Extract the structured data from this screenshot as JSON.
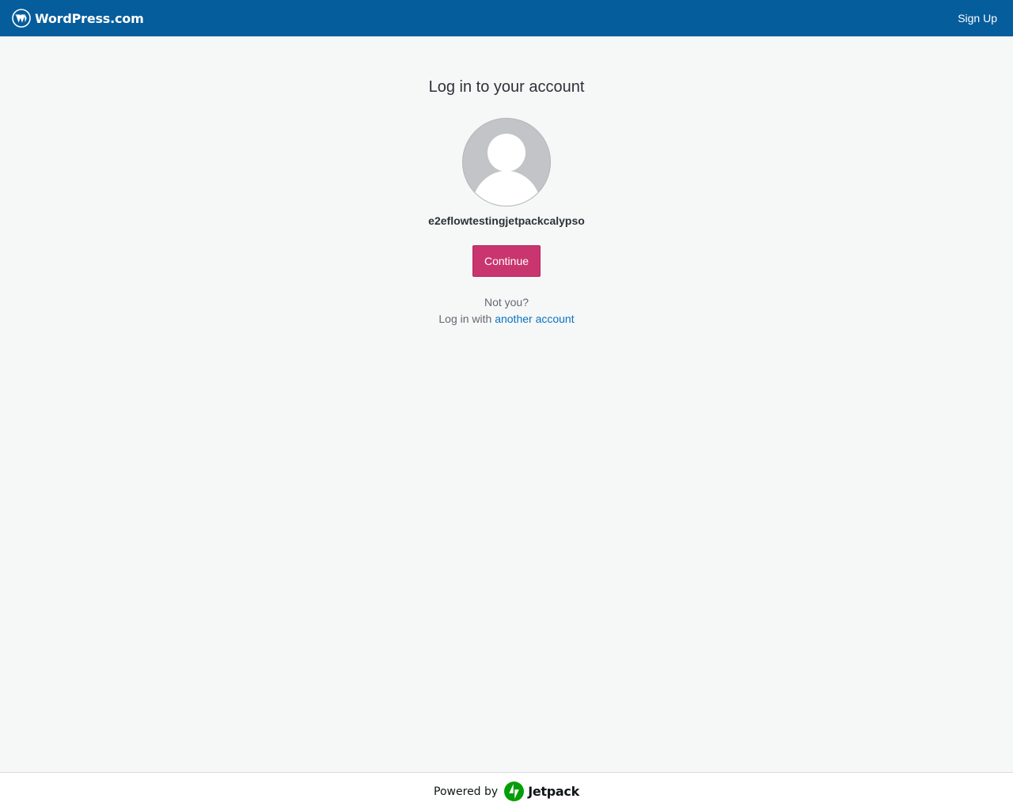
{
  "header": {
    "brand_name": "WordPress.com",
    "brand_icon": "wordpress-logo-icon",
    "signup_label": "Sign Up",
    "background_color": "#065d9c"
  },
  "login": {
    "title": "Log in to your account",
    "avatar_icon": "default-user-avatar-icon",
    "username": "e2eflowtestingjetpackcalypso",
    "continue_label": "Continue",
    "continue_color": "#c9356e",
    "not_you_text": "Not you?",
    "login_with_prefix": "Log in with",
    "another_account_link": "another account",
    "link_color": "#0675c4"
  },
  "footer": {
    "powered_by_text": "Powered by",
    "jetpack_icon": "jetpack-logo-icon",
    "jetpack_name": "Jetpack",
    "jetpack_color": "#069e08"
  }
}
